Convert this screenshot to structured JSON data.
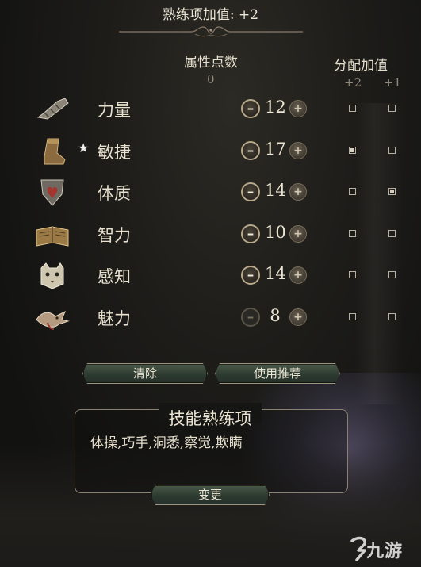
{
  "header": {
    "title": "熟练项加值: +2"
  },
  "columns": {
    "attribute_points_label": "属性点数",
    "attribute_points_value": "0",
    "bonus_label": "分配加值",
    "bonus_plus2": "+2",
    "bonus_plus1": "+1"
  },
  "abilities": [
    {
      "name": "力量",
      "value": "12",
      "star": "",
      "icon": "gauntlet-icon",
      "bonus_plus2": false,
      "bonus_plus1": false,
      "minus_enabled": true
    },
    {
      "name": "敏捷",
      "value": "17",
      "star": "★",
      "icon": "boot-icon",
      "bonus_plus2": true,
      "bonus_plus1": false,
      "minus_enabled": true
    },
    {
      "name": "体质",
      "value": "14",
      "star": "",
      "icon": "heart-shield-icon",
      "bonus_plus2": false,
      "bonus_plus1": true,
      "minus_enabled": true
    },
    {
      "name": "智力",
      "value": "10",
      "star": "",
      "icon": "open-book-icon",
      "bonus_plus2": false,
      "bonus_plus1": false,
      "minus_enabled": true
    },
    {
      "name": "感知",
      "value": "14",
      "star": "",
      "icon": "owlbear-icon",
      "bonus_plus2": false,
      "bonus_plus1": false,
      "minus_enabled": true
    },
    {
      "name": "魅力",
      "value": "8",
      "star": "",
      "icon": "bird-icon",
      "bonus_plus2": false,
      "bonus_plus1": false,
      "minus_enabled": false
    }
  ],
  "buttons": {
    "clear": "清除",
    "use_recommended": "使用推荐",
    "change": "变更"
  },
  "skills": {
    "title": "技能熟练项",
    "list": "体操,巧手,洞悉,察觉,欺瞒"
  },
  "watermark": {
    "text": "九游"
  }
}
